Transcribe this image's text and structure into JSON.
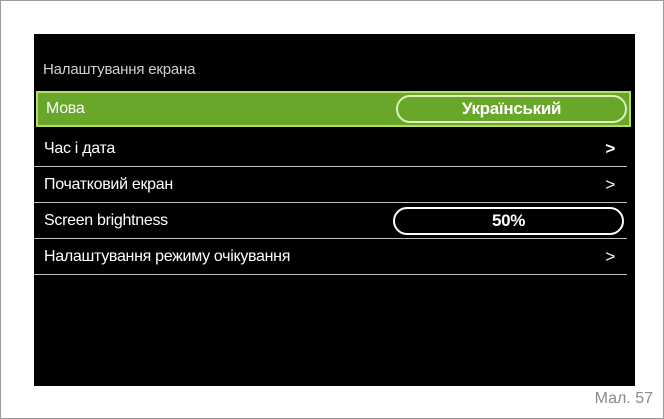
{
  "screen": {
    "title": "Налаштування екрана",
    "rows": [
      {
        "label": "Мова",
        "value": "Український"
      },
      {
        "label": "Час і дата",
        "action": ">"
      },
      {
        "label": "Початковий екран",
        "action": ">"
      },
      {
        "label": "Screen brightness",
        "value": "50%"
      },
      {
        "label": "Налаштування режиму очікування",
        "action": ">"
      }
    ]
  },
  "caption": "Мал. 57",
  "colors": {
    "screen_background": "#000000",
    "selected_row": "#68a72a",
    "selected_row_border": "#b6dd66"
  }
}
